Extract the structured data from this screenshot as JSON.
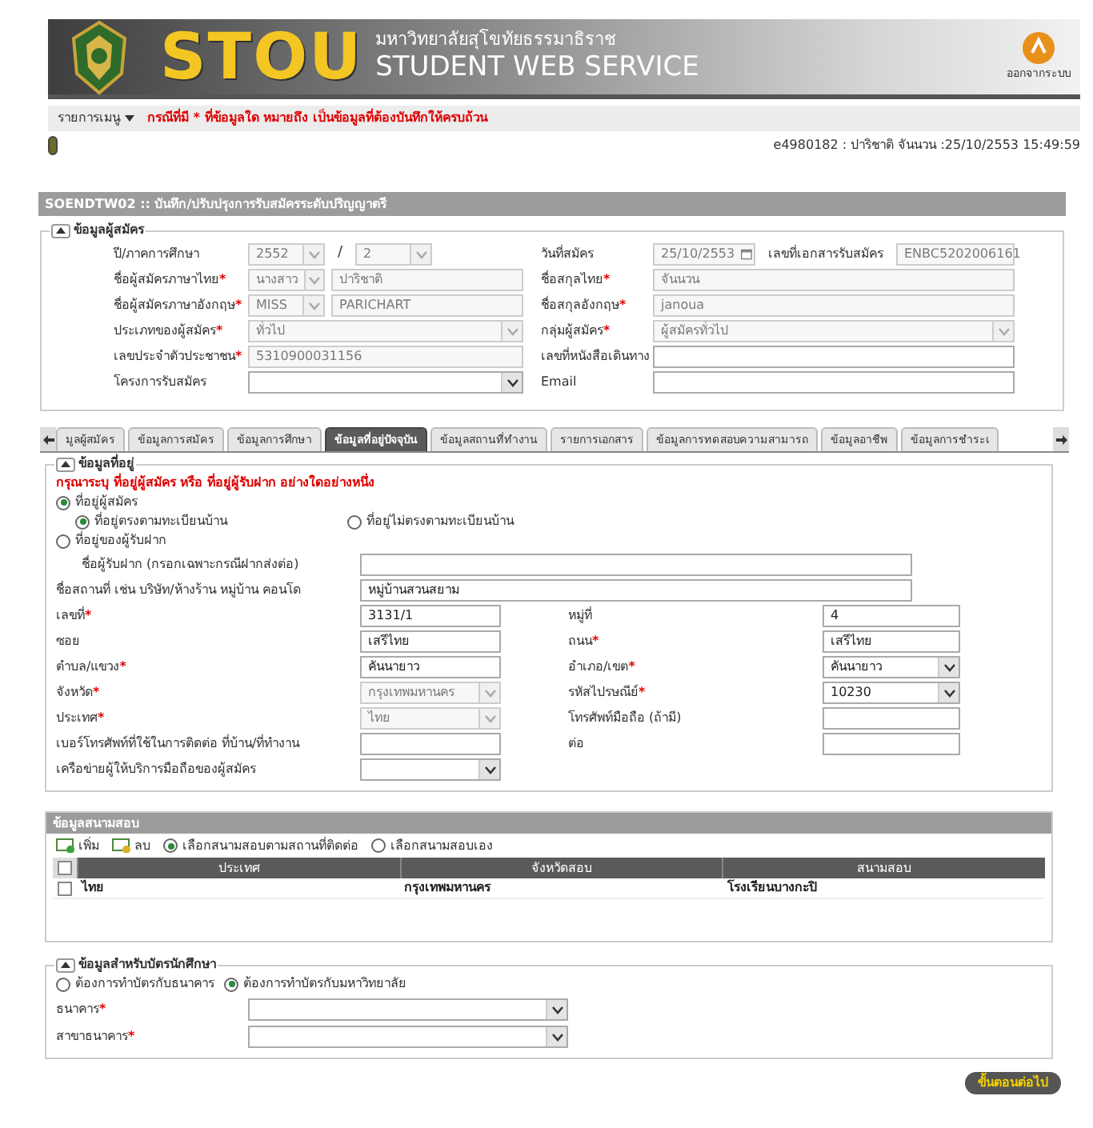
{
  "header": {
    "logo": "STOU",
    "university": "มหาวิทยาลัยสุโขทัยธรรมาธิราช",
    "service": "STUDENT WEB SERVICE",
    "logout": "ออกจากระบบ"
  },
  "menu": {
    "label": "รายการเมนู",
    "notice": "กรณีที่มี * ที่ข้อมูลใด หมายถึง เป็นข้อมูลที่ต้องบันทึกให้ครบถ้วน"
  },
  "user_info": "e4980182 : ปาริชาติ จันนวน :25/10/2553 15:49:59",
  "page_title": "SOENDTW02 :: บันทึก/ปรับปรุงการรับสมัครระดับปริญญาตรี",
  "applicant": {
    "title": "ข้อมูลผู้สมัคร",
    "expanded": true,
    "rows": [
      {
        "left": {
          "label": "ปี/ภาคการศึกษา",
          "controls": [
            {
              "kind": "select",
              "value": "2552",
              "disabled": true
            },
            {
              "kind": "separator",
              "text": "/"
            },
            {
              "kind": "select",
              "value": "2",
              "disabled": true
            }
          ]
        },
        "right": {
          "label": "วันที่สมัคร",
          "controls": [
            {
              "kind": "date",
              "value": "25/10/2553",
              "disabled": true
            },
            {
              "kind": "label",
              "text": "เลขที่เอกสารรับสมัคร"
            },
            {
              "kind": "text",
              "value": "ENBC5202006161",
              "disabled": true
            }
          ]
        }
      },
      {
        "left": {
          "label": "ชื่อผู้สมัครภาษาไทย",
          "mark": "*",
          "controls": [
            {
              "kind": "select",
              "value": "นางสาว",
              "disabled": true
            },
            {
              "kind": "text",
              "value": "ปาริชาติ",
              "disabled": true
            }
          ]
        },
        "right": {
          "label": "ชื่อสกุลไทย",
          "mark": "*",
          "controls": [
            {
              "kind": "text",
              "value": "จันนวน",
              "disabled": true
            }
          ]
        }
      },
      {
        "left": {
          "label": "ชื่อผู้สมัครภาษาอังกฤษ",
          "mark": "*",
          "controls": [
            {
              "kind": "select",
              "value": "MISS",
              "disabled": true
            },
            {
              "kind": "text",
              "value": "PARICHART",
              "disabled": true
            }
          ]
        },
        "right": {
          "label": "ชื่อสกุลอังกฤษ",
          "mark": "*",
          "controls": [
            {
              "kind": "text",
              "value": "janoua",
              "disabled": true
            }
          ]
        }
      },
      {
        "left": {
          "label": "ประเภทของผู้สมัคร",
          "mark": "*",
          "controls": [
            {
              "kind": "select",
              "value": "ทั่วไป",
              "disabled": true
            }
          ]
        },
        "right": {
          "label": "กลุ่มผู้สมัคร",
          "mark": "*",
          "controls": [
            {
              "kind": "select",
              "value": "ผู้สมัครทั่วไป",
              "disabled": true
            }
          ]
        }
      },
      {
        "left": {
          "label": "เลขประจำตัวประชาชน",
          "mark": "*",
          "controls": [
            {
              "kind": "text",
              "value": "5310900031156",
              "disabled": true
            }
          ]
        },
        "right": {
          "label": "เลขที่หนังสือเดินทาง",
          "controls": [
            {
              "kind": "text",
              "disabled": false
            }
          ]
        }
      },
      {
        "left": {
          "label": "โครงการรับสมัคร",
          "controls": [
            {
              "kind": "select",
              "disabled": false
            }
          ]
        },
        "right": {
          "label": "Email",
          "controls": [
            {
              "kind": "text",
              "disabled": false
            }
          ]
        }
      }
    ]
  },
  "tabs": [
    {
      "label": "มูลผู้สมัคร",
      "selected": false
    },
    {
      "label": "ข้อมูลการสมัคร",
      "selected": false
    },
    {
      "label": "ข้อมูลการศึกษา",
      "selected": false
    },
    {
      "label": "ข้อมูลที่อยู่ปัจจุบัน",
      "selected": true
    },
    {
      "label": "ข้อมูลสถานที่ทำงาน",
      "selected": false
    },
    {
      "label": "รายการเอกสาร",
      "selected": false
    },
    {
      "label": "ข้อมูลการทดสอบความสามารถ",
      "selected": false
    },
    {
      "label": "ข้อมูลอาชีพ",
      "selected": false
    },
    {
      "label": "ข้อมูลการชำระเ",
      "selected": false
    }
  ],
  "address": {
    "title": "ข้อมูลที่อยู่",
    "expanded": true,
    "notice": "กรุณาระบุ ที่อยู่ผู้สมัคร หรือ ที่อยู่ผู้รับฝาก อย่างใดอย่างหนึ่ง",
    "options": [
      {
        "label": "ที่อยู่ผู้สมัคร",
        "selected": true,
        "children": [
          {
            "label": "ที่อยู่ตรงตามทะเบียนบ้าน",
            "selected": true
          },
          {
            "label": "ที่อยู่ไม่ตรงตามทะเบียนบ้าน",
            "selected": false
          }
        ]
      },
      {
        "label": "ที่อยู่ของผู้รับฝาก",
        "selected": false
      }
    ],
    "wide_fields": [
      {
        "label": "ชื่อผู้รับฝาก (กรอกเฉพาะกรณีฝากส่งต่อ)",
        "indent": true,
        "controls": [
          {
            "kind": "text",
            "disabled": false
          }
        ]
      },
      {
        "label": "ชื่อสถานที่ เช่น บริษัท/ห้างร้าน หมู่บ้าน คอนโด",
        "indent": false,
        "controls": [
          {
            "kind": "text",
            "value": "หมู่บ้านสวนสยาม",
            "disabled": false
          }
        ]
      }
    ],
    "rows": [
      {
        "left": {
          "label": "เลขที่",
          "mark": "*",
          "controls": [
            {
              "kind": "text",
              "value": "3131/1",
              "disabled": false
            }
          ]
        },
        "right": {
          "label": "หมู่ที่",
          "controls": [
            {
              "kind": "text",
              "value": "4",
              "disabled": false
            }
          ]
        }
      },
      {
        "left": {
          "label": "ซอย",
          "controls": [
            {
              "kind": "text",
              "value": "เสรีไทย",
              "disabled": false
            }
          ]
        },
        "right": {
          "label": "ถนน",
          "mark": "*",
          "controls": [
            {
              "kind": "text",
              "value": "เสรีไทย",
              "disabled": false
            }
          ]
        }
      },
      {
        "left": {
          "label": "ตำบล/แขวง",
          "mark": "*",
          "controls": [
            {
              "kind": "text",
              "value": "คันนายาว",
              "disabled": false
            }
          ]
        },
        "right": {
          "label": "อำเภอ/เขต",
          "mark": "*",
          "controls": [
            {
              "kind": "select",
              "value": "คันนายาว",
              "disabled": false
            }
          ]
        }
      },
      {
        "left": {
          "label": "จังหวัด",
          "mark": "*",
          "controls": [
            {
              "kind": "select",
              "value": "กรุงเทพมหานคร",
              "disabled": true
            }
          ]
        },
        "right": {
          "label": "รหัสไปรษณีย์",
          "mark": "*",
          "controls": [
            {
              "kind": "select",
              "value": "10230",
              "disabled": false
            }
          ]
        }
      },
      {
        "left": {
          "label": "ประเทศ",
          "mark": "*",
          "controls": [
            {
              "kind": "select",
              "value": "ไทย",
              "disabled": true
            }
          ]
        },
        "right": {
          "label": "โทรศัพท์มือถือ (ถ้ามี)",
          "controls": [
            {
              "kind": "text",
              "disabled": false
            }
          ]
        }
      },
      {
        "left": {
          "label": "เบอร์โทรศัพท์ที่ใช้ในการติดต่อ ที่บ้าน/ที่ทำงาน",
          "controls": [
            {
              "kind": "text",
              "disabled": false
            }
          ]
        },
        "right": {
          "label": "ต่อ",
          "controls": [
            {
              "kind": "text",
              "disabled": false
            }
          ]
        }
      },
      {
        "left": {
          "label": "เครือข่ายผู้ให้บริการมือถือของผู้สมัคร",
          "controls": [
            {
              "kind": "select",
              "disabled": false
            }
          ]
        }
      }
    ]
  },
  "exam": {
    "title": "ข้อมูลสนามสอบ",
    "actions": [
      "เพิ่ม",
      "ลบ"
    ],
    "modes": [
      {
        "label": "เลือกสนามสอบตามสถานที่ติดต่อ",
        "selected": true
      },
      {
        "label": "เลือกสนามสอบเอง",
        "selected": false
      }
    ],
    "columns": [
      "ประเทศ",
      "จังหวัดสอบ",
      "สนามสอบ"
    ],
    "all_checked": false,
    "rows": [
      {
        "checked": false,
        "cells": [
          "ไทย",
          "กรุงเทพมหานคร",
          "โรงเรียนบางกะปิ"
        ]
      }
    ]
  },
  "card": {
    "title": "ข้อมูลสำหรับบัตรนักศึกษา",
    "expanded": true,
    "options": [
      {
        "label": "ต้องการทำบัตรกับธนาคาร",
        "selected": false
      },
      {
        "label": "ต้องการทำบัตรกับมหาวิทยาลัย",
        "selected": true
      }
    ],
    "fields": [
      {
        "label": "ธนาคาร",
        "mark": "*",
        "controls": [
          {
            "kind": "select",
            "disabled": false
          }
        ]
      },
      {
        "label": "สาขาธนาคาร",
        "mark": "*",
        "controls": [
          {
            "kind": "select",
            "disabled": false
          }
        ]
      }
    ]
  },
  "next_button": "ขั้นตอนต่อไป"
}
